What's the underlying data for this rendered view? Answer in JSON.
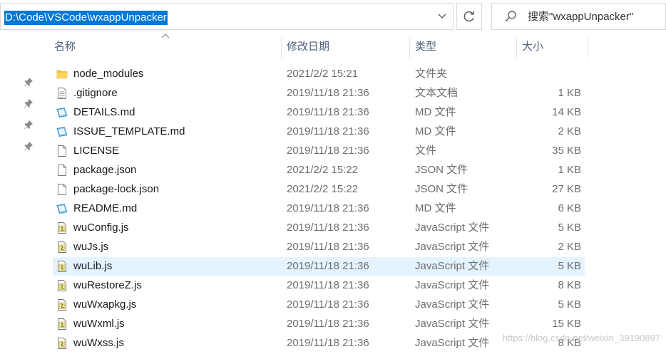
{
  "address_bar": {
    "path": "D:\\Code\\VSCode\\wxappUnpacker"
  },
  "search": {
    "placeholder": "搜索\"wxappUnpacker\""
  },
  "columns": {
    "name": "名称",
    "date": "修改日期",
    "type": "类型",
    "size": "大小"
  },
  "files": [
    {
      "name": "node_modules",
      "date": "2021/2/2 15:21",
      "type": "文件夹",
      "size": "",
      "icon": "folder-icon"
    },
    {
      "name": ".gitignore",
      "date": "2019/11/18 21:36",
      "type": "文本文档",
      "size": "1 KB",
      "icon": "text-file-icon"
    },
    {
      "name": "DETAILS.md",
      "date": "2019/11/18 21:36",
      "type": "MD 文件",
      "size": "14 KB",
      "icon": "markdown-file-icon"
    },
    {
      "name": "ISSUE_TEMPLATE.md",
      "date": "2019/11/18 21:36",
      "type": "MD 文件",
      "size": "2 KB",
      "icon": "markdown-file-icon"
    },
    {
      "name": "LICENSE",
      "date": "2019/11/18 21:36",
      "type": "文件",
      "size": "35 KB",
      "icon": "blank-file-icon"
    },
    {
      "name": "package.json",
      "date": "2021/2/2 15:22",
      "type": "JSON 文件",
      "size": "1 KB",
      "icon": "blank-file-icon"
    },
    {
      "name": "package-lock.json",
      "date": "2021/2/2 15:22",
      "type": "JSON 文件",
      "size": "27 KB",
      "icon": "blank-file-icon"
    },
    {
      "name": "README.md",
      "date": "2019/11/18 21:36",
      "type": "MD 文件",
      "size": "6 KB",
      "icon": "markdown-file-icon"
    },
    {
      "name": "wuConfig.js",
      "date": "2019/11/18 21:36",
      "type": "JavaScript 文件",
      "size": "5 KB",
      "icon": "js-file-icon"
    },
    {
      "name": "wuJs.js",
      "date": "2019/11/18 21:36",
      "type": "JavaScript 文件",
      "size": "2 KB",
      "icon": "js-file-icon"
    },
    {
      "name": "wuLib.js",
      "date": "2019/11/18 21:36",
      "type": "JavaScript 文件",
      "size": "5 KB",
      "icon": "js-file-icon",
      "selected": true
    },
    {
      "name": "wuRestoreZ.js",
      "date": "2019/11/18 21:36",
      "type": "JavaScript 文件",
      "size": "8 KB",
      "icon": "js-file-icon"
    },
    {
      "name": "wuWxapkg.js",
      "date": "2019/11/18 21:36",
      "type": "JavaScript 文件",
      "size": "5 KB",
      "icon": "js-file-icon"
    },
    {
      "name": "wuWxml.js",
      "date": "2019/11/18 21:36",
      "type": "JavaScript 文件",
      "size": "15 KB",
      "icon": "js-file-icon"
    },
    {
      "name": "wuWxss.js",
      "date": "2019/11/18 21:36",
      "type": "JavaScript 文件",
      "size": "8 KB",
      "icon": "js-file-icon"
    }
  ],
  "watermark": "https://blog.csdn.net/weixin_39190897",
  "colors": {
    "selection": "#0078d7",
    "row_highlight": "#e5f3ff",
    "header_text": "#4c607a"
  }
}
